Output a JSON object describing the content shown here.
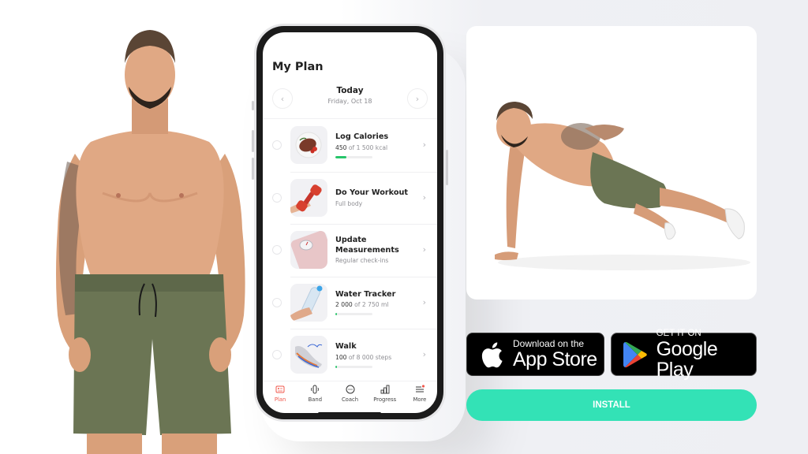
{
  "colors": {
    "accent_install": "#33e2b6",
    "active_tab": "#f0584c",
    "progress_green": "#27c56a",
    "shorts": "#6b7554"
  },
  "phone": {
    "screen_title": "My Plan",
    "date_nav": {
      "label": "Today",
      "date": "Friday, Oct 18",
      "prev_icon": "chevron-left-icon",
      "next_icon": "chevron-right-icon"
    },
    "tasks": [
      {
        "title": "Log Calories",
        "value": "450",
        "of_text": " of 1 500 kcal",
        "progress": 0.3,
        "thumbnail": "steak-plate",
        "completed": false
      },
      {
        "title": "Do Your Workout",
        "subtitle": "Full body",
        "thumbnail": "dumbbell",
        "completed": false
      },
      {
        "title": "Update Measurements",
        "subtitle": "Regular check-ins",
        "thumbnail": "scale",
        "completed": false
      },
      {
        "title": "Water Tracker",
        "value": "2 000",
        "of_text": " of 2 750 ml",
        "progress": 0.05,
        "thumbnail": "water-bottle",
        "completed": false
      },
      {
        "title": "Walk",
        "value": "100",
        "of_text": " of 8 000 steps",
        "progress": 0.05,
        "thumbnail": "sneaker",
        "completed": false
      }
    ],
    "tabbar": [
      {
        "label": "Plan",
        "icon": "plan-icon",
        "active": true
      },
      {
        "label": "Band",
        "icon": "band-icon",
        "active": false
      },
      {
        "label": "Coach",
        "icon": "chat-icon",
        "active": false
      },
      {
        "label": "Progress",
        "icon": "bar-chart-icon",
        "active": false
      },
      {
        "label": "More",
        "icon": "menu-icon",
        "active": false,
        "notification_dot": true
      }
    ]
  },
  "badges": {
    "apple": {
      "small": "Download on the",
      "big": "App Store"
    },
    "google": {
      "small": "GET IT ON",
      "big": "Google Play"
    }
  },
  "install": {
    "label": "INSTALL"
  }
}
